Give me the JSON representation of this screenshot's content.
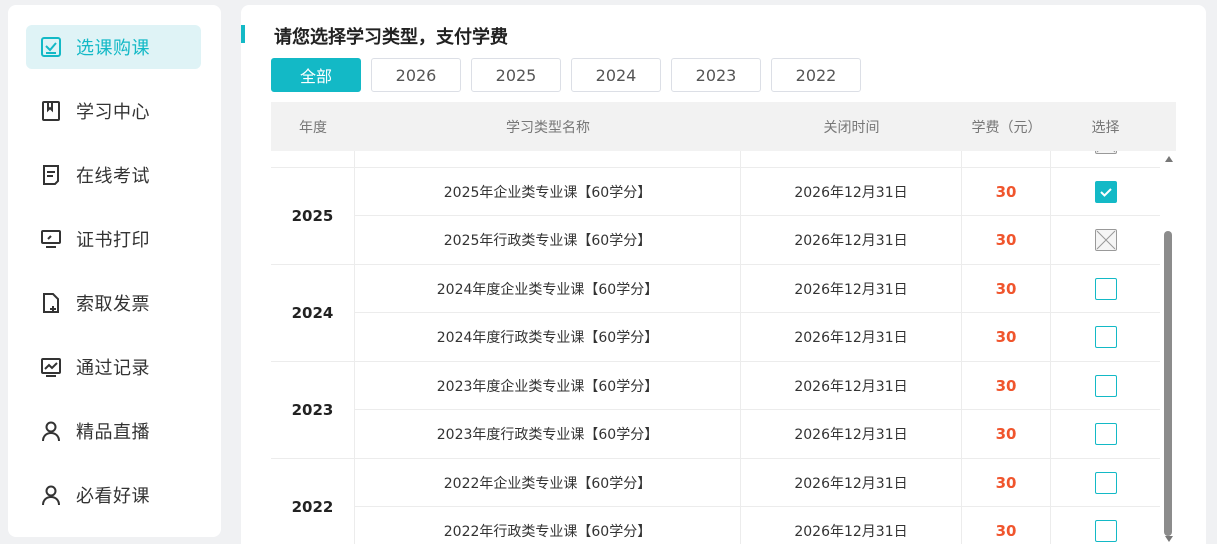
{
  "sidebar": {
    "items": [
      {
        "label": "选课购课",
        "icon": "checklist-icon",
        "active": true
      },
      {
        "label": "学习中心",
        "icon": "bookmark-book-icon",
        "active": false
      },
      {
        "label": "在线考试",
        "icon": "document-icon",
        "active": false
      },
      {
        "label": "证书打印",
        "icon": "monitor-icon",
        "active": false
      },
      {
        "label": "索取发票",
        "icon": "file-plus-icon",
        "active": false
      },
      {
        "label": "通过记录",
        "icon": "chart-icon",
        "active": false
      },
      {
        "label": "精品直播",
        "icon": "user-icon",
        "active": false
      },
      {
        "label": "必看好课",
        "icon": "user-icon",
        "active": false
      }
    ]
  },
  "main": {
    "title": "请您选择学习类型，支付学费",
    "filters": [
      {
        "label": "全部",
        "active": true
      },
      {
        "label": "2026",
        "active": false
      },
      {
        "label": "2025",
        "active": false
      },
      {
        "label": "2024",
        "active": false
      },
      {
        "label": "2023",
        "active": false
      },
      {
        "label": "2022",
        "active": false
      }
    ],
    "table": {
      "headers": {
        "year": "年度",
        "name": "学习类型名称",
        "close": "关闭时间",
        "fee": "学费（元）",
        "select": "选择"
      },
      "groups": [
        {
          "year": "",
          "rows": [
            {
              "name": "",
              "close": "",
              "fee": "",
              "state": "disabled"
            }
          ]
        },
        {
          "year": "2025",
          "rows": [
            {
              "name": "2025年企业类专业课【60学分】",
              "close": "2026年12月31日",
              "fee": "30",
              "state": "checked"
            },
            {
              "name": "2025年行政类专业课【60学分】",
              "close": "2026年12月31日",
              "fee": "30",
              "state": "disabled"
            }
          ]
        },
        {
          "year": "2024",
          "rows": [
            {
              "name": "2024年度企业类专业课【60学分】",
              "close": "2026年12月31日",
              "fee": "30",
              "state": "unchecked"
            },
            {
              "name": "2024年度行政类专业课【60学分】",
              "close": "2026年12月31日",
              "fee": "30",
              "state": "unchecked"
            }
          ]
        },
        {
          "year": "2023",
          "rows": [
            {
              "name": "2023年度企业类专业课【60学分】",
              "close": "2026年12月31日",
              "fee": "30",
              "state": "unchecked"
            },
            {
              "name": "2023年度行政类专业课【60学分】",
              "close": "2026年12月31日",
              "fee": "30",
              "state": "unchecked"
            }
          ]
        },
        {
          "year": "2022",
          "rows": [
            {
              "name": "2022年企业类专业课【60学分】",
              "close": "2026年12月31日",
              "fee": "30",
              "state": "unchecked"
            },
            {
              "name": "2022年行政类专业课【60学分】",
              "close": "2026年12月31日",
              "fee": "30",
              "state": "unchecked"
            }
          ]
        }
      ]
    }
  },
  "colors": {
    "accent": "#13b9c6",
    "fee": "#f0552d"
  }
}
